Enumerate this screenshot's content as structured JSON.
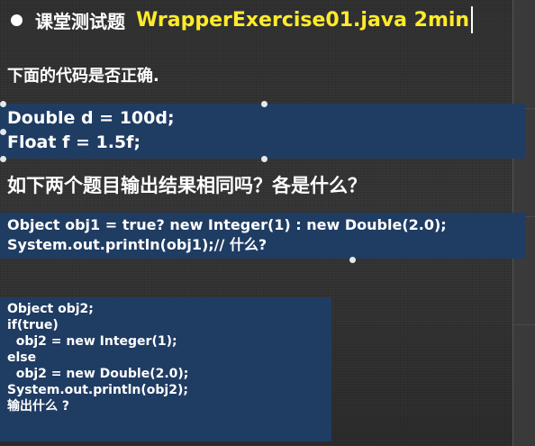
{
  "slide": {
    "title_cn": "课堂测试题",
    "title_file": "WrapperExercise01.java 2min",
    "subtitle": "下面的代码是否正确.",
    "box1_lines": [
      "Double d = 100d;",
      "Float f = 1.5f;"
    ],
    "question": "如下两个题目输出结果相同吗？各是什么？",
    "box2_lines": [
      "Object obj1 = true? new Integer(1) : new Double(2.0);",
      "System.out.println(obj1);// 什么?"
    ],
    "box3_lines": [
      "Object obj2;",
      "if(true)",
      "  obj2 = new Integer(1);",
      "else",
      "  obj2 = new Double(2.0);",
      "System.out.println(obj2);",
      "输出什么 ?"
    ]
  },
  "colors": {
    "accent_yellow": "#ffeb2a",
    "code_box_blue": "#1f3c63"
  },
  "icons": {
    "bullet": "bullet-icon",
    "selection_handle": "selection-handle-icon"
  }
}
